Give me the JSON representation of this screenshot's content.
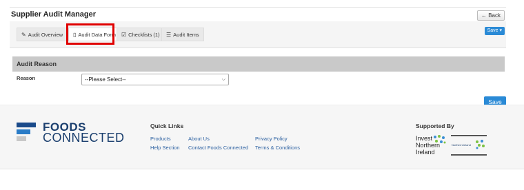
{
  "header": {
    "title": "Supplier Audit Manager",
    "back_label": "Back",
    "back_icon": "←"
  },
  "tabs": [
    {
      "label": "Audit Overview",
      "icon": "✎"
    },
    {
      "label": "Audit Data Form",
      "icon": "▯"
    },
    {
      "label": "Checklists (1)",
      "icon": "☑"
    },
    {
      "label": "Audit Items",
      "icon": "☰"
    }
  ],
  "save_dropdown_label": "Save ▾",
  "section": {
    "title": "Audit Reason",
    "reason_label": "Reason",
    "reason_value": "--Please Select--"
  },
  "save_button_label": "Save",
  "footer": {
    "logo_word1": "FOODS",
    "logo_word2": "CONNECTED",
    "quick_links_title": "Quick Links",
    "links": [
      "Products",
      "About Us",
      "Privacy Policy",
      "Help Section",
      "Contact Foods Connected",
      "Terms & Conditions"
    ],
    "supported_by": "Supported By",
    "invest_lines": [
      "Invest",
      "Northern",
      "Ireland"
    ],
    "ni_logo_text": "NorthernIreland"
  },
  "colors": {
    "accent": "#2a8ad6",
    "highlight": "#e00000",
    "logo_dark": "#1b3f6e"
  }
}
